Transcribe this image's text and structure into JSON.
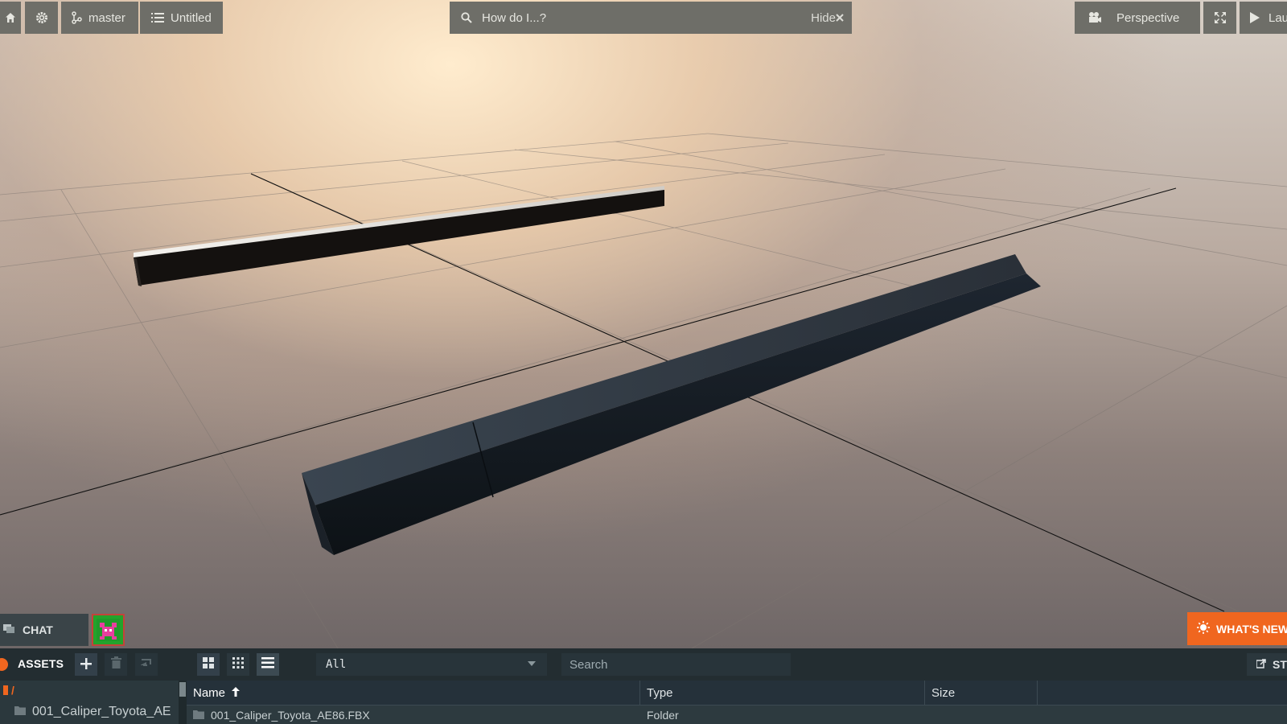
{
  "toolbar": {
    "branch_label": "master",
    "scene_label": "Untitled",
    "help_search_placeholder": "How do I...?",
    "hide_label": "Hide",
    "camera_label": "Perspective",
    "launch_label": "Lau"
  },
  "chat": {
    "label": "CHAT"
  },
  "whats_new": {
    "label": "WHAT'S NEW"
  },
  "assets": {
    "title": "ASSETS",
    "filter_value": "All",
    "search_placeholder": "Search",
    "store_label": "ST",
    "tree_root": "/",
    "tree_items": [
      "001_Caliper_Toyota_AE"
    ],
    "columns": {
      "name": "Name",
      "type": "Type",
      "size": "Size"
    },
    "rows": [
      {
        "name": "001_Caliper_Toyota_AE86.FBX",
        "type": "Folder"
      }
    ]
  },
  "icons": {
    "home": "home-icon",
    "settings": "gear-icon",
    "branch": "branch-icon",
    "scene": "list-icon",
    "search": "search-icon",
    "hide": "close-icon",
    "camera": "camera-icon",
    "fullscreen": "fullscreen-icon",
    "launch": "play-icon",
    "chat": "chat-icon",
    "whats_new": "lightbulb-icon",
    "add": "plus-icon",
    "delete": "trash-icon",
    "move": "move-icon",
    "view_grid_large": "grid-large-icon",
    "view_grid_small": "grid-small-icon",
    "view_list": "list-view-icon",
    "sort": "arrow-up-icon",
    "folder": "folder-icon"
  },
  "colors": {
    "accent": "#f0661f",
    "toolbar_bg": "#6e6e68",
    "panel_bg": "#2d3a3f"
  }
}
